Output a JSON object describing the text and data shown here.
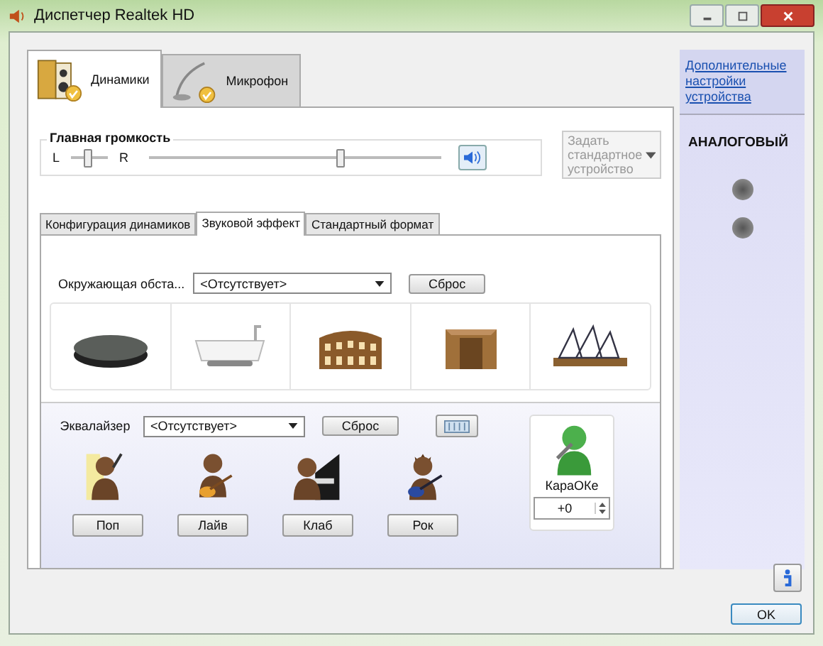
{
  "window": {
    "title": "Диспетчер Realtek HD"
  },
  "device_tabs": [
    {
      "label": "Динамики",
      "selected": true,
      "kind": "speakers"
    },
    {
      "label": "Микрофон",
      "selected": false,
      "kind": "microphone"
    }
  ],
  "main_volume": {
    "label": "Главная громкость",
    "balance_left": "L",
    "balance_right": "R",
    "balance": {
      "level": 0.45
    },
    "volume": {
      "level": 0.66
    }
  },
  "default_device_button": {
    "label": "Задать стандартное устройство",
    "disabled": true
  },
  "effect_tabs": [
    {
      "label": "Конфигурация динамиков",
      "selected": false
    },
    {
      "label": "Звуковой эффект",
      "selected": true
    },
    {
      "label": "Стандартный формат",
      "selected": false
    }
  ],
  "environment": {
    "label": "Окружающая обста...",
    "value": "<Отсутствует>",
    "reset": "Сброс",
    "presets": [
      {
        "kind": "disc"
      },
      {
        "kind": "bathtub"
      },
      {
        "kind": "colosseum"
      },
      {
        "kind": "ruin"
      },
      {
        "kind": "opera"
      }
    ]
  },
  "equalizer": {
    "label": "Эквалайзер",
    "value": "<Отсутствует>",
    "reset": "Сброс",
    "presets": [
      {
        "label": "Поп",
        "kind": "pop"
      },
      {
        "label": "Лайв",
        "kind": "live"
      },
      {
        "label": "Клаб",
        "kind": "club"
      },
      {
        "label": "Рок",
        "kind": "rock"
      }
    ]
  },
  "karaoke": {
    "label": "КараОКе",
    "value": "+0"
  },
  "side_panel": {
    "link": "Дополнительные настройки устройства",
    "section": "АНАЛОГОВЫЙ"
  },
  "ok_button": "OK"
}
